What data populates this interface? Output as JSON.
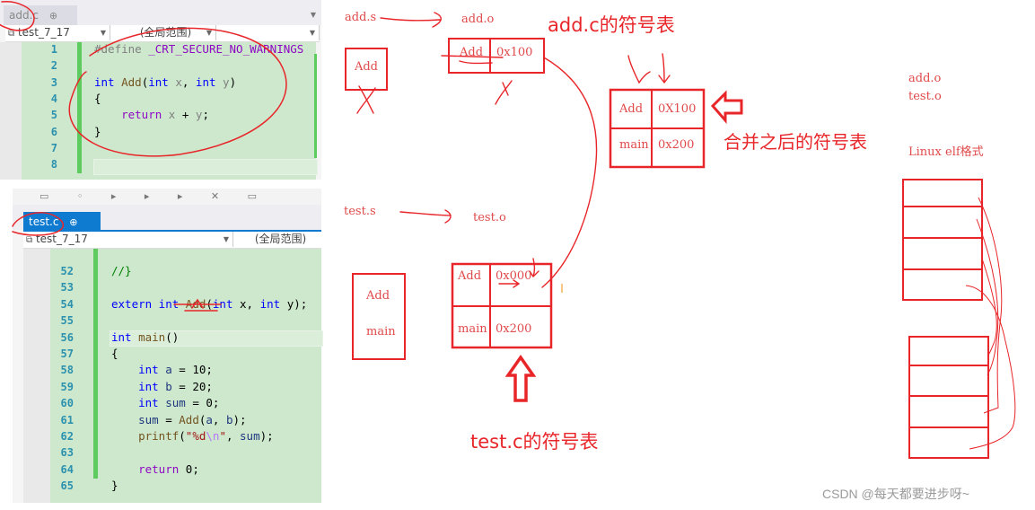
{
  "editor_add": {
    "tab": {
      "label": "add.c",
      "pin": "⊕",
      "close": "×"
    },
    "nav": {
      "project": "test_7_17",
      "scope": "(全局范围)",
      "member": ""
    },
    "lines": [
      {
        "no": "1",
        "code": [
          {
            "t": "pp",
            "v": "#define "
          },
          {
            "t": "mac",
            "v": "_CRT_SECURE_NO_WARNINGS"
          }
        ]
      },
      {
        "no": "2",
        "code": []
      },
      {
        "no": "3",
        "code": [
          {
            "t": "kw",
            "v": "int "
          },
          {
            "t": "fn",
            "v": "Add"
          },
          {
            "t": "pl",
            "v": "("
          },
          {
            "t": "kw",
            "v": "int "
          },
          {
            "t": "var",
            "v": "x"
          },
          {
            "t": "pl",
            "v": ", "
          },
          {
            "t": "kw",
            "v": "int "
          },
          {
            "t": "var",
            "v": "y"
          },
          {
            "t": "pl",
            "v": ")"
          }
        ]
      },
      {
        "no": "4",
        "code": [
          {
            "t": "pl",
            "v": "{"
          }
        ]
      },
      {
        "no": "5",
        "code": [
          {
            "t": "pl",
            "v": "    "
          },
          {
            "t": "ret",
            "v": "return "
          },
          {
            "t": "var",
            "v": "x"
          },
          {
            "t": "pl",
            "v": " + "
          },
          {
            "t": "var",
            "v": "y"
          },
          {
            "t": "pl",
            "v": ";"
          }
        ]
      },
      {
        "no": "6",
        "code": [
          {
            "t": "pl",
            "v": "}"
          }
        ]
      },
      {
        "no": "7",
        "code": []
      },
      {
        "no": "8",
        "code": []
      }
    ]
  },
  "editor_test": {
    "tab": {
      "label": "test.c",
      "pin": "⊕",
      "close": "×"
    },
    "nav": {
      "project": "test_7_17",
      "scope": "(全局范围)"
    },
    "lines": [
      {
        "no": "52",
        "code": [
          {
            "t": "cm",
            "v": "//}"
          }
        ]
      },
      {
        "no": "53",
        "code": []
      },
      {
        "no": "54",
        "code": [
          {
            "t": "kw",
            "v": "extern int "
          },
          {
            "t": "fn",
            "v": "Add"
          },
          {
            "t": "pl",
            "v": "("
          },
          {
            "t": "kw",
            "v": "int "
          },
          {
            "t": "pl",
            "v": "x, "
          },
          {
            "t": "kw",
            "v": "int "
          },
          {
            "t": "pl",
            "v": "y);"
          }
        ]
      },
      {
        "no": "55",
        "code": []
      },
      {
        "no": "56",
        "code": [
          {
            "t": "kw",
            "v": "int "
          },
          {
            "t": "fn",
            "v": "main"
          },
          {
            "t": "pl",
            "v": "()"
          }
        ]
      },
      {
        "no": "57",
        "code": [
          {
            "t": "pl",
            "v": "{"
          }
        ]
      },
      {
        "no": "58",
        "code": [
          {
            "t": "pl",
            "v": "    "
          },
          {
            "t": "kw",
            "v": "int "
          },
          {
            "t": "lv",
            "v": "a"
          },
          {
            "t": "pl",
            "v": " = 10;"
          }
        ]
      },
      {
        "no": "59",
        "code": [
          {
            "t": "pl",
            "v": "    "
          },
          {
            "t": "kw",
            "v": "int "
          },
          {
            "t": "lv",
            "v": "b"
          },
          {
            "t": "pl",
            "v": " = 20;"
          }
        ]
      },
      {
        "no": "60",
        "code": [
          {
            "t": "pl",
            "v": "    "
          },
          {
            "t": "kw",
            "v": "int "
          },
          {
            "t": "lv",
            "v": "sum"
          },
          {
            "t": "pl",
            "v": " = 0;"
          }
        ]
      },
      {
        "no": "61",
        "code": [
          {
            "t": "pl",
            "v": "    "
          },
          {
            "t": "lv",
            "v": "sum"
          },
          {
            "t": "pl",
            "v": " = "
          },
          {
            "t": "fn",
            "v": "Add"
          },
          {
            "t": "pl",
            "v": "("
          },
          {
            "t": "lv",
            "v": "a"
          },
          {
            "t": "pl",
            "v": ", "
          },
          {
            "t": "lv",
            "v": "b"
          },
          {
            "t": "pl",
            "v": ");"
          }
        ]
      },
      {
        "no": "62",
        "code": [
          {
            "t": "pl",
            "v": "    "
          },
          {
            "t": "fn",
            "v": "printf"
          },
          {
            "t": "pl",
            "v": "("
          },
          {
            "t": "str",
            "v": "\"%d"
          },
          {
            "t": "esc",
            "v": "\\n"
          },
          {
            "t": "str",
            "v": "\""
          },
          {
            "t": "pl",
            "v": ", "
          },
          {
            "t": "lv",
            "v": "sum"
          },
          {
            "t": "pl",
            "v": ");"
          }
        ]
      },
      {
        "no": "63",
        "code": []
      },
      {
        "no": "64",
        "code": [
          {
            "t": "pl",
            "v": "    "
          },
          {
            "t": "ret",
            "v": "return "
          },
          {
            "t": "pl",
            "v": "0;"
          }
        ]
      },
      {
        "no": "65",
        "code": [
          {
            "t": "pl",
            "v": "}"
          }
        ]
      }
    ]
  },
  "diagram": {
    "add_flow": {
      "src": "add.s",
      "dst": "add.o"
    },
    "add_obj_box": "Add",
    "add_symtab": [
      {
        "name": "Add",
        "addr": "0x100"
      }
    ],
    "add_symtab_title": "add.c的符号表",
    "merged_symtab": [
      {
        "name": "Add",
        "addr": "0X100"
      },
      {
        "name": "main",
        "addr": "0x200"
      }
    ],
    "merged_title": "合并之后的符号表",
    "test_flow": {
      "src": "test.s",
      "dst": "test.o"
    },
    "test_obj_box": [
      "Add",
      "main"
    ],
    "test_symtab": [
      {
        "name": "Add",
        "addr": "0x000"
      },
      {
        "name": "main",
        "addr": "0x200"
      }
    ],
    "test_symtab_title": "test.c的符号表",
    "files": [
      "add.o",
      "test.o"
    ],
    "format_label": "Linux elf格式"
  },
  "watermark": "CSDN @每天都要进步呀~",
  "colors": {
    "ink": "#e8262a",
    "code_bg": "#cde8cd",
    "tab_active": "#0e7ad0"
  }
}
